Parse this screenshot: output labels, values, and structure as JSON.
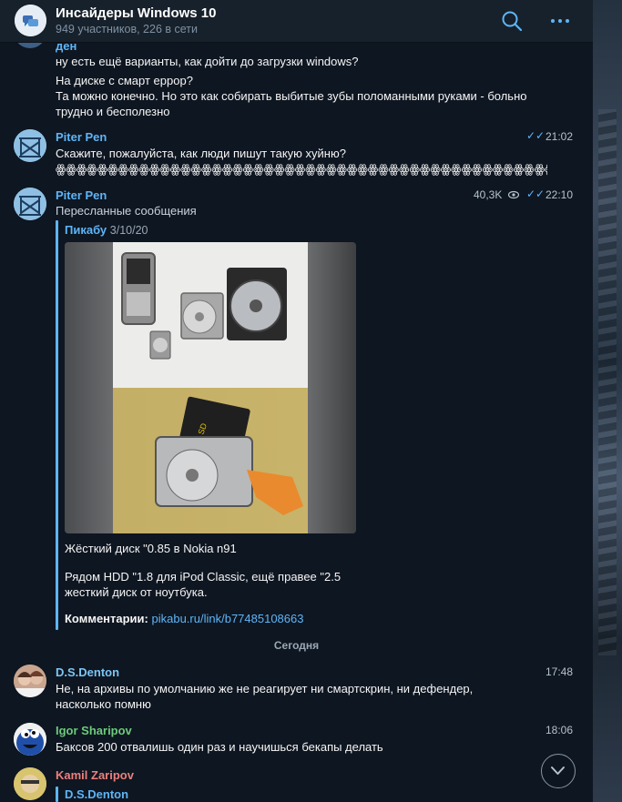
{
  "header": {
    "title": "Инсайдеры Windows 10",
    "subtitle": "949 участников, 226 в сети"
  },
  "messages": {
    "m0": {
      "sender": "ден",
      "line1": "ну есть ещё варианты, как дойти до загрузки windows?",
      "line2": "На диске с смарт еррор?\nТа можно конечно. Но это как собирать выбитые зубы поломанными руками - больно трудно и бесполезно"
    },
    "m1": {
      "sender": "Piter Pen",
      "text": "Скажите, пожалуйста, как люди пишут такую хуйню?\nꙮꙮꙮꙮꙮꙮꙮꙮꙮꙮꙮꙮꙮꙮꙮꙮꙮꙮꙮꙮꙮꙮꙮꙮꙮꙮꙮꙮꙮꙮꙮꙮꙮꙮꙮꙮꙮꙮꙮꙮꙮꙮꙮꙮꙮꙮꙮꙮꙮꙮꙮꙮꙮꙮꙮꙮꙮ",
      "time": "21:02"
    },
    "m2": {
      "sender": "Piter Pen",
      "forwarded_label": "Пересланные сообщения",
      "views": "40,3K",
      "time": "22:10",
      "fwd_source": "Пикабу",
      "fwd_date": "3/10/20",
      "caption1": "Жёсткий диск \"0.85 в Nokia n91",
      "caption2": "Рядом HDD \"1.8 для iPod Classic, ещё правее \"2.5\nжесткий диск от ноутбука.",
      "comments_label": "Комментарии:",
      "comments_link": "pikabu.ru/link/b77485108663"
    },
    "m3": {
      "sender": "D.S.Denton",
      "text": "Не, на архивы по умолчанию же не реагирует ни смартскрин, ни дефендер,\nнасколько помню",
      "time": "17:48"
    },
    "m4": {
      "sender": "Igor Sharipov",
      "text": "Баксов 200 отвалишь один раз и научишься бекапы делать",
      "time": "18:06"
    },
    "m5": {
      "sender": "Kamil Zaripov",
      "reply_to": "D.S.Denton"
    }
  },
  "date_separator": "Сегодня",
  "colors": {
    "background": "#0e1621",
    "header": "#17212b",
    "accent": "#5eb5f7",
    "name_piter": "#5eb5f7",
    "name_denton": "#7cc6f5",
    "name_igor": "#6ccb7a",
    "name_kamil": "#ee7f7b"
  },
  "icons": [
    "search-icon",
    "more-icon",
    "read-ticks-icon",
    "views-eye-icon",
    "chevron-down-icon"
  ]
}
